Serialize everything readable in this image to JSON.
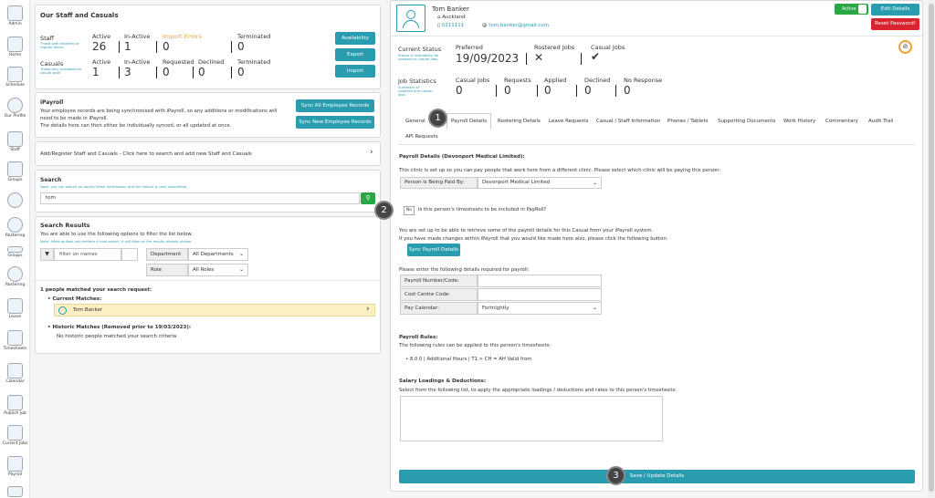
{
  "sidebar": [
    {
      "label": "Admin",
      "icon": "admin-icon"
    },
    {
      "label": "Home",
      "icon": "home-icon"
    },
    {
      "label": "Schedule",
      "icon": "schedule-icon"
    },
    {
      "label": "Our Profile",
      "icon": "profile-icon"
    },
    {
      "label": "Staff",
      "icon": "staff-icon"
    },
    {
      "label": "Groups",
      "icon": "groups-icon"
    },
    {
      "label": "",
      "icon": "network-icon"
    },
    {
      "label": "Rostering",
      "icon": "rostering-icon"
    },
    {
      "label": "Groups",
      "icon": "groups-icon"
    },
    {
      "label": "Rostering",
      "icon": "rostering-icon"
    },
    {
      "label": "Leave",
      "icon": "leave-icon"
    },
    {
      "label": "Timesheets",
      "icon": "timesheets-icon"
    },
    {
      "label": "Calendar",
      "icon": "calendar-icon"
    },
    {
      "label": "Publish Job",
      "icon": "publish-job-icon"
    },
    {
      "label": "Current Jobs",
      "icon": "current-jobs-icon"
    },
    {
      "label": "Payroll",
      "icon": "payroll-icon"
    }
  ],
  "staff_panel": {
    "title": "Our Staff and Casuals",
    "staff_label": "Staff",
    "staff_sub": "Those with rostered or regular hours",
    "casuals_label": "Casuals",
    "casuals_sub": "Those only available for casual work",
    "h_active": "Active",
    "h_inactive": "In-Active",
    "h_import_errors": "Import Errors",
    "h_terminated": "Terminated",
    "h_requested": "Requested",
    "h_declined": "Declined",
    "staff_active": "26",
    "staff_inactive": "1",
    "staff_import_errors": "0",
    "staff_terminated": "0",
    "cas_active": "1",
    "cas_inactive": "3",
    "cas_requested": "0",
    "cas_declined": "0",
    "cas_terminated": "0",
    "btn_availability": "Availability",
    "btn_export": "Export",
    "btn_import": "Import"
  },
  "ipayroll": {
    "title": "iPayroll",
    "text1": "Your employee records are being synchronised with iPayroll, so any additions or modifications will need to be made in iPayroll.",
    "text2": "The details here can then either be individually synced, or all updated at once.",
    "btn_sync_all": "Sync All Employee Records",
    "btn_sync_new": "Sync New Employee Records"
  },
  "add_register": "Add/Register Staff and Casuals - Click here to search and add new Staff and Casuals",
  "search": {
    "title": "Search",
    "note": "Note: you can search on partial name information and the search is case insensitive.",
    "value": "tom"
  },
  "results": {
    "title": "Search Results",
    "desc": "You are able to use the following options to filter the list below.",
    "note": "Note: filtering does not perform a new search, it will filter on the results already shown.",
    "filter_placeholder": "filter on names",
    "department_label": "Department",
    "department_value": "All Departments",
    "role_label": "Role",
    "role_value": "All Roles",
    "matched": "1 people matched your search request:",
    "current_title": "Current Matches:",
    "current_name": "Tom Banker",
    "historic_title": "Historic Matches (Removed prior to 19/03/2023):",
    "historic_text": "No historic people matched your search criteria"
  },
  "profile": {
    "name": "Tom Banker",
    "location": "Auckland",
    "phone": "0211111",
    "email": "tom.banker@gmail.com",
    "active": "Active",
    "btn_edit": "Edit Details",
    "btn_reset": "Reset Password!",
    "status_title": "Current Status",
    "status_sub": "Status & availability for rostered or casual jobs",
    "preferred_label": "Preferred",
    "preferred_value": "19/09/2023",
    "rostered_label": "Rostered Jobs",
    "casual_label": "Casual Jobs",
    "stats_title": "Job Statistics",
    "stats_sub": "Summary of rostered and casual jobs",
    "s_casual": "Casual Jobs",
    "s_requests": "Requests",
    "s_applied": "Applied",
    "s_declined": "Declined",
    "s_noresponse": "No Response",
    "v_casual": "0",
    "v_requests": "0",
    "v_applied": "0",
    "v_declined": "0",
    "v_noresponse": "0"
  },
  "tabs": [
    "General",
    "Payroll Details",
    "Rostering Details",
    "Leave Requests",
    "Casual / Staff Information",
    "Phones / Tablets",
    "Supporting Documents",
    "Work History",
    "Commentary",
    "Audit Trail",
    "API Requests"
  ],
  "payroll": {
    "title": "Payroll Details (Devonport Medical Limited):",
    "clinic_text": "This clinic is set up so you can pay people that work here from a different clinic. Please select which clinic will be paying this person:",
    "paid_by_label": "Person is Being Paid By:",
    "paid_by_value": "Devonport Medical Limited",
    "no_label": "No",
    "included_text": "Is this person's timesheets to be included in PayRoll?",
    "retrieve1": "You are set up to be able to retrieve some of the payroll details for this Casual from your iPayroll system.",
    "retrieve2": "If you have made changes within iPayroll that you would like made here also, please click the following button:",
    "btn_sync_payroll": "Sync Payroll Details",
    "enter_text": "Please enter the following details required for payroll:",
    "payroll_number": "Payroll Number/Code:",
    "cost_centre": "Cost Centre Code:",
    "pay_calendar": "Pay Calendar:",
    "pay_calendar_value": "Fortnightly",
    "rules_title": "Payroll Rules:",
    "rules_text": "The following rules can be applied to this person's timesheets:",
    "rule_item": "8.0.0 | Additional Hours | T1 > CH = AH  Valid from",
    "loadings_title": "Salary Loadings & Deductions:",
    "loadings_text": "Select from the following list, to apply the appropriate loadings / deductions and rates to this person's timesheets:",
    "btn_save": "Save / Update Details"
  },
  "callouts": [
    "1",
    "2",
    "3"
  ],
  "colors": {
    "accent": "#2a9cb0",
    "green": "#27a844",
    "red": "#d9232e",
    "orange": "#f0a030",
    "highlight": "#fcefc4"
  }
}
